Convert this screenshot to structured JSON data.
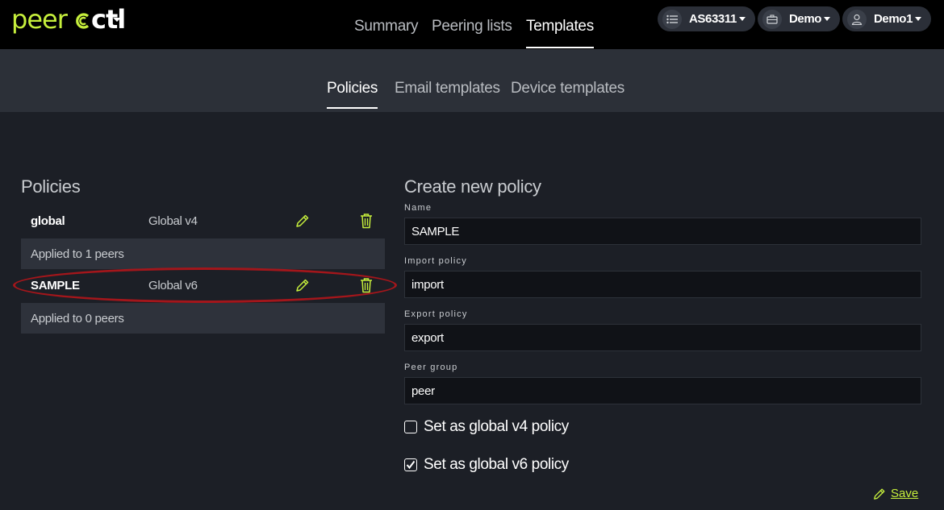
{
  "colors": {
    "accent": "#c6ef3c",
    "bg": "#1c1f26",
    "topbar": "#000000",
    "subbar": "#2c3038",
    "highlight": "#a3161b"
  },
  "logo": {
    "prefix": "peer",
    "suffix": "ctl"
  },
  "topnav": [
    "Summary",
    "Peering lists",
    "Templates"
  ],
  "topnav_active": "Templates",
  "account_pills": [
    {
      "icon": "list-icon",
      "label": "AS63311"
    },
    {
      "icon": "briefcase-icon",
      "label": "Demo"
    },
    {
      "icon": "user-icon",
      "label": "Demo1"
    }
  ],
  "subnav": [
    "Policies",
    "Email templates",
    "Device templates"
  ],
  "subnav_active": "Policies",
  "policies": {
    "heading": "Policies",
    "items": [
      {
        "name": "global",
        "desc": "Global v4",
        "applied": "Applied to 1 peers"
      },
      {
        "name": "SAMPLE",
        "desc": "Global v6",
        "applied": "Applied to 0 peers"
      }
    ]
  },
  "form": {
    "heading": "Create new policy",
    "name_label": "Name",
    "name_value": "SAMPLE",
    "import_label": "Import policy",
    "import_value": "import",
    "export_label": "Export policy",
    "export_value": "export",
    "group_label": "Peer group",
    "group_value": "peer",
    "v4_label": "Set as global v4 policy",
    "v4_checked": false,
    "v6_label": "Set as global v6 policy",
    "v6_checked": true,
    "save_label": "Save"
  }
}
